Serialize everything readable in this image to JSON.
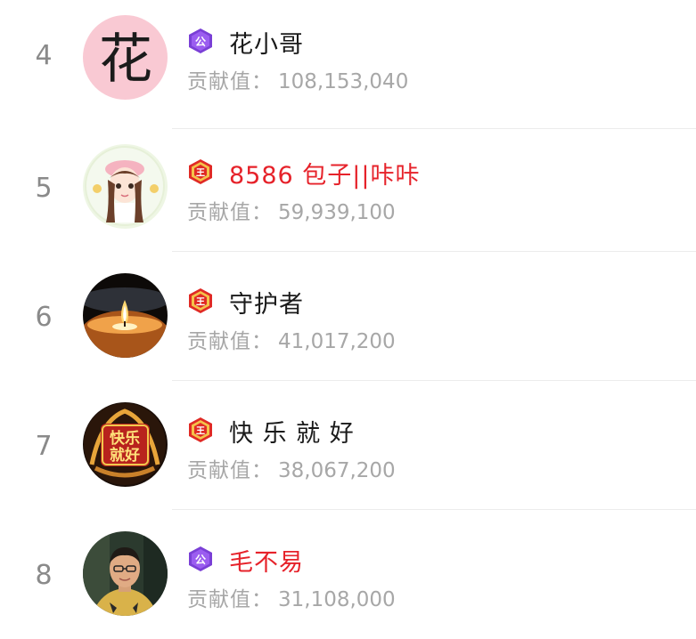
{
  "leaderboard": {
    "entries": [
      {
        "rank": "4",
        "name": "花小哥",
        "badge": "公",
        "badge_type": "union-purple",
        "name_color": "#1a1a1a",
        "contrib_label": "贡献值：",
        "contrib_value": "108,153,040",
        "avatar_text": "花"
      },
      {
        "rank": "5",
        "name": "8586 包子||咔咔",
        "badge": "王",
        "badge_type": "king-red",
        "name_color": "#e6222a",
        "contrib_label": "贡献值：",
        "contrib_value": "59,939,100"
      },
      {
        "rank": "6",
        "name": "守护者",
        "badge": "王",
        "badge_type": "king-red",
        "name_color": "#1a1a1a",
        "contrib_label": "贡献值：",
        "contrib_value": "41,017,200"
      },
      {
        "rank": "7",
        "name": "快 乐 就 好",
        "badge": "王",
        "badge_type": "king-red",
        "name_color": "#1a1a1a",
        "contrib_label": "贡献值：",
        "contrib_value": "38,067,200",
        "avatar_text_1": "快乐",
        "avatar_text_2": "就好"
      },
      {
        "rank": "8",
        "name": "毛不易",
        "badge": "公",
        "badge_type": "union-purple",
        "name_color": "#e6222a",
        "contrib_label": "贡献值：",
        "contrib_value": "31,108,000"
      }
    ]
  },
  "colors": {
    "rank": "#8a8a8a",
    "contrib": "#a7a7a7",
    "highlight_name": "#e6222a",
    "union_badge": "#7a3fd6",
    "king_badge": "#e02a25"
  }
}
